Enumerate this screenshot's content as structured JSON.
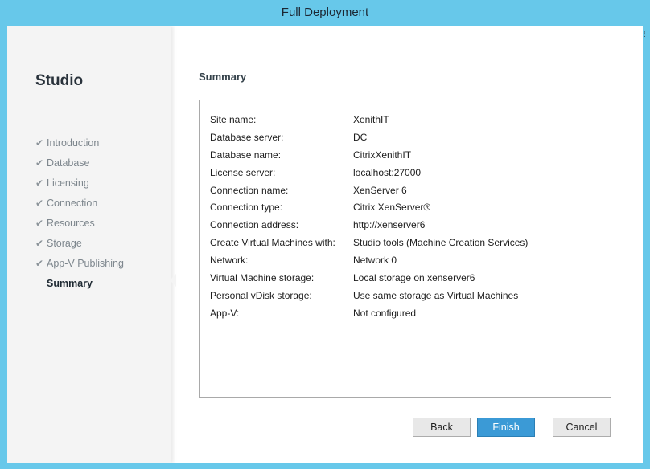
{
  "window": {
    "title": "Full Deployment"
  },
  "nav": {
    "title": "Studio",
    "steps": [
      {
        "label": "Introduction",
        "done": true
      },
      {
        "label": "Database",
        "done": true
      },
      {
        "label": "Licensing",
        "done": true
      },
      {
        "label": "Connection",
        "done": true
      },
      {
        "label": "Resources",
        "done": true
      },
      {
        "label": "Storage",
        "done": true
      },
      {
        "label": "App-V Publishing",
        "done": true
      },
      {
        "label": "Summary",
        "done": false,
        "current": true
      }
    ],
    "check_glyph": "✔"
  },
  "main": {
    "title": "Summary",
    "rows": [
      {
        "label": "Site name:",
        "value": "XenithIT"
      },
      {
        "label": "Database server:",
        "value": "DC"
      },
      {
        "label": "Database name:",
        "value": "CitrixXenithIT"
      },
      {
        "label": "License server:",
        "value": "localhost:27000"
      },
      {
        "label": "Connection name:",
        "value": "XenServer 6"
      },
      {
        "label": "Connection type:",
        "value": "Citrix XenServer®"
      },
      {
        "label": "Connection address:",
        "value": "http://xenserver6"
      },
      {
        "label": "Create Virtual Machines with:",
        "value": "Studio tools (Machine Creation Services)"
      },
      {
        "label": "Network:",
        "value": "Network 0"
      },
      {
        "label": "Virtual Machine storage:",
        "value": "Local storage on xenserver6"
      },
      {
        "label": "Personal vDisk storage:",
        "value": "Use same storage as Virtual Machines"
      },
      {
        "label": "App-V:",
        "value": "Not configured"
      }
    ]
  },
  "buttons": {
    "back": "Back",
    "finish": "Finish",
    "cancel": "Cancel"
  },
  "colors": {
    "titlebar": "#67c8ea",
    "finish": "#3b9ad6",
    "nav_bg": "#f4f4f4"
  }
}
